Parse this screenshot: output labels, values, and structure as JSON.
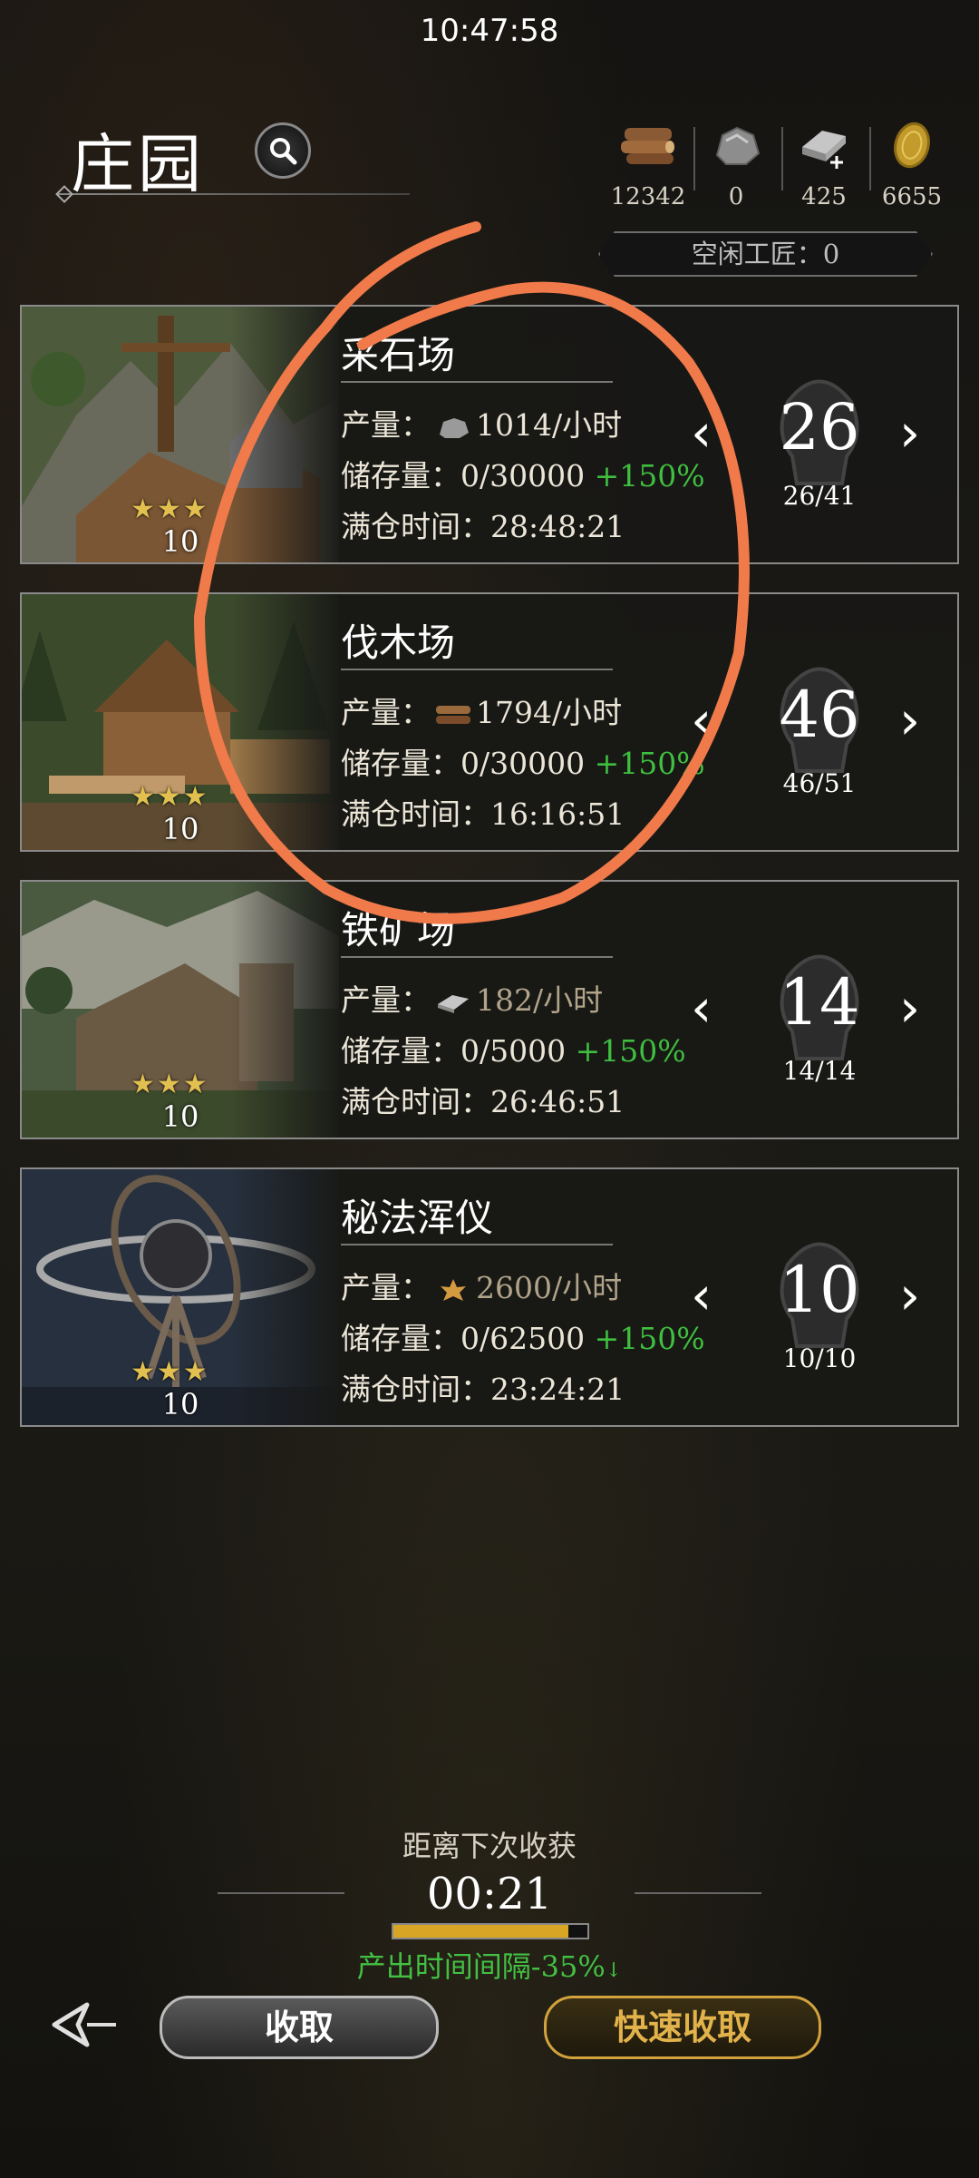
{
  "status_bar": {
    "time": "10:47:58"
  },
  "header": {
    "title": "庄园"
  },
  "resources": [
    {
      "icon": "wood-icon",
      "value": "12342"
    },
    {
      "icon": "stone-icon",
      "value": "0"
    },
    {
      "icon": "iron-icon",
      "value": "425"
    },
    {
      "icon": "gold-coin-icon",
      "value": "6655"
    }
  ],
  "idle_workers": {
    "label": "空闲工匠：0"
  },
  "labels": {
    "output": "产量：",
    "storage": "储存量：",
    "full_time": "满仓时间："
  },
  "buildings": [
    {
      "name": "采石场",
      "stars": "★★★",
      "level": "10",
      "resource_icon": "stone-icon",
      "output": "1014/小时",
      "storage": "0/30000",
      "boost": "+150%",
      "full_time": "28:48:21",
      "workers": "26",
      "workers_frac": "26/41"
    },
    {
      "name": "伐木场",
      "stars": "★★★",
      "level": "10",
      "resource_icon": "wood-icon",
      "output": "1794/小时",
      "storage": "0/30000",
      "boost": "+150%",
      "full_time": "16:16:51",
      "workers": "46",
      "workers_frac": "46/51"
    },
    {
      "name": "铁矿场",
      "stars": "★★★",
      "level": "10",
      "resource_icon": "iron-icon",
      "output": "182/小时",
      "storage": "0/5000",
      "boost": "+150%",
      "full_time": "26:46:51",
      "workers": "14",
      "workers_frac": "14/14"
    },
    {
      "name": "秘法浑仪",
      "stars": "★★★",
      "level": "10",
      "resource_icon": "arcane-icon",
      "output": "2600/小时",
      "storage": "0/62500",
      "boost": "+150%",
      "full_time": "23:24:21",
      "workers": "10",
      "workers_frac": "10/10"
    }
  ],
  "harvest": {
    "label": "距离下次收获",
    "timer": "00:21",
    "progress": 0.9,
    "interval": "产出时间间隔-35%"
  },
  "buttons": {
    "collect": "收取",
    "fast_collect": "快速收取"
  },
  "colors": {
    "boost": "#3fbf3f",
    "accent_gold": "#d2a23c",
    "annotation": "#f07a4a"
  }
}
